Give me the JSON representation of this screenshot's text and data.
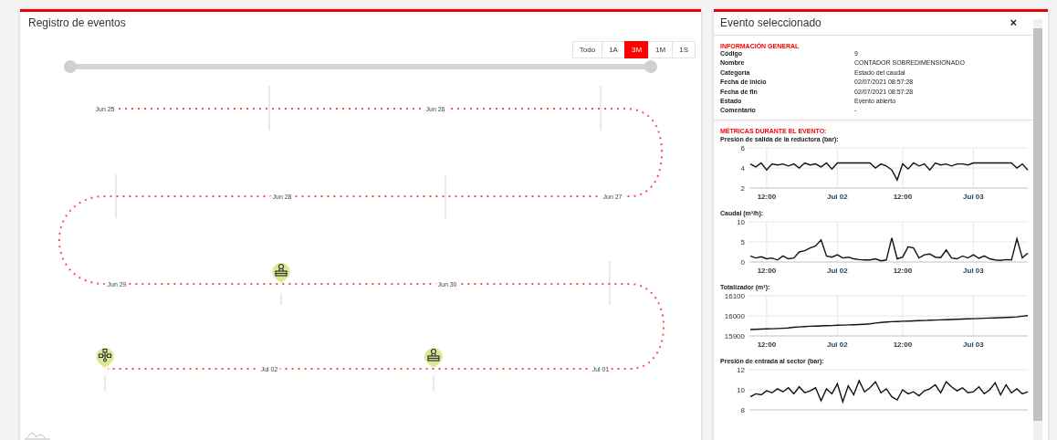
{
  "event_log": {
    "title": "Registro de eventos",
    "range_buttons": [
      {
        "label": "Todo",
        "selected": false
      },
      {
        "label": "1A",
        "selected": false
      },
      {
        "label": "3M",
        "selected": true
      },
      {
        "label": "1M",
        "selected": false
      },
      {
        "label": "1S",
        "selected": false
      }
    ],
    "range_slider": {
      "level": 1
    },
    "timeline": {
      "dates": [
        "Jun 25",
        "Jun 26",
        "Jun 28",
        "Jun 27",
        "Jun 29",
        "Jun 30",
        "Jul 02",
        "Jul 01"
      ],
      "events": [
        {
          "kind": "meter"
        },
        {
          "kind": "network"
        },
        {
          "kind": "meter"
        }
      ]
    }
  },
  "selected_event": {
    "title": "Evento seleccionado",
    "close": "×",
    "general_heading": "INFORMACIÓN GENERAL",
    "fields": [
      {
        "label": "Código",
        "value": "9"
      },
      {
        "label": "Nombre",
        "value": "CONTADOR SOBREDIMENSIONADO"
      },
      {
        "label": "Categoría",
        "value": "Estado del caudal"
      },
      {
        "label": "Fecha de inicio",
        "value": "02/07/2021 08:57:28"
      },
      {
        "label": "Fecha de fin",
        "value": "02/07/2021 08:57:28"
      },
      {
        "label": "Estado",
        "value": "Evento abierto"
      },
      {
        "label": "Comentario",
        "value": "-"
      }
    ],
    "metrics_heading": "MÉTRICAS DURANTE EL EVENTO:",
    "charts": [
      {
        "chart_data": {
          "type": "line",
          "title": "Presión de salida de la reductora (bar):",
          "grid": true,
          "ylim": [
            2,
            6
          ],
          "yticks": [
            2,
            4,
            6
          ],
          "categories": [
            null,
            null,
            null,
            "12:00",
            null,
            null,
            null,
            null,
            null,
            null,
            null,
            null,
            null,
            null,
            null,
            null,
            "Jul 02",
            null,
            null,
            null,
            null,
            null,
            null,
            null,
            null,
            null,
            null,
            null,
            "12:00",
            null,
            null,
            null,
            null,
            null,
            null,
            null,
            null,
            null,
            null,
            null,
            null,
            "Jul 03",
            null,
            null,
            null,
            null,
            null,
            null,
            null,
            null,
            null,
            null
          ],
          "values": [
            4.4,
            4.1,
            4.5,
            3.8,
            4.4,
            4.3,
            4.4,
            4.2,
            4.4,
            4.0,
            4.5,
            4.3,
            4.4,
            4.1,
            4.5,
            3.9,
            4.5,
            4.5,
            4.5,
            4.5,
            4.5,
            4.5,
            4.5,
            4.0,
            4.4,
            4.2,
            3.8,
            2.8,
            4.4,
            3.9,
            4.5,
            4.2,
            4.4,
            3.8,
            4.5,
            4.3,
            4.4,
            4.2,
            4.4,
            4.4,
            4.3,
            4.5,
            4.5,
            4.5,
            4.5,
            4.5,
            4.5,
            4.5,
            4.5,
            4.0,
            4.4,
            3.8
          ]
        }
      },
      {
        "chart_data": {
          "type": "line",
          "title": "Caudal (m³/h):",
          "grid": true,
          "ylim": [
            0,
            10
          ],
          "yticks": [
            0,
            5,
            10
          ],
          "categories": [
            null,
            null,
            null,
            "12:00",
            null,
            null,
            null,
            null,
            null,
            null,
            null,
            null,
            null,
            null,
            null,
            null,
            "Jul 02",
            null,
            null,
            null,
            null,
            null,
            null,
            null,
            null,
            null,
            null,
            null,
            "12:00",
            null,
            null,
            null,
            null,
            null,
            null,
            null,
            null,
            null,
            null,
            null,
            null,
            "Jul 03",
            null,
            null,
            null,
            null,
            null,
            null,
            null,
            null,
            null,
            null
          ],
          "values": [
            1.5,
            1,
            1.3,
            0.8,
            1,
            0.5,
            1.5,
            0.8,
            1,
            2.5,
            2.8,
            3.5,
            4,
            5.5,
            1.5,
            1.2,
            1.8,
            1,
            1.2,
            0.8,
            0.6,
            0.5,
            0.5,
            0.8,
            0.3,
            0.5,
            6,
            0.8,
            1.2,
            3.8,
            3.5,
            1,
            1.8,
            2,
            1.2,
            1.1,
            3,
            1,
            0.8,
            1.5,
            1,
            1.8,
            0.9,
            1.5,
            0.8,
            0.5,
            0.4,
            0.6,
            0.5,
            5.8,
            1,
            2.2
          ]
        }
      },
      {
        "chart_data": {
          "type": "line",
          "title": "Totalizador (m³):",
          "grid": true,
          "ylim": [
            15900,
            16100
          ],
          "yticks": [
            15900,
            16000,
            16100
          ],
          "categories": [
            null,
            null,
            null,
            "12:00",
            null,
            null,
            null,
            null,
            null,
            null,
            null,
            null,
            null,
            null,
            null,
            null,
            "Jul 02",
            null,
            null,
            null,
            null,
            null,
            null,
            null,
            null,
            null,
            null,
            null,
            "12:00",
            null,
            null,
            null,
            null,
            null,
            null,
            null,
            null,
            null,
            null,
            null,
            null,
            "Jul 03",
            null,
            null,
            null,
            null,
            null,
            null,
            null,
            null,
            null,
            null
          ],
          "values": [
            15932,
            15933,
            15934,
            15935,
            15936,
            15937,
            15938,
            15940,
            15943,
            15945,
            15947,
            15948,
            15949,
            15950,
            15951,
            15952,
            15953,
            15954,
            15955,
            15956,
            15957,
            15958,
            15960,
            15964,
            15967,
            15969,
            15971,
            15972,
            15973,
            15974,
            15975,
            15976,
            15977,
            15978,
            15979,
            15980,
            15981,
            15982,
            15983,
            15984,
            15985,
            15986,
            15987,
            15988,
            15989,
            15990,
            15991,
            15992,
            15993,
            15995,
            15998,
            16001
          ]
        }
      },
      {
        "chart_data": {
          "type": "line",
          "title": "Presión de entrada al sector (bar):",
          "grid": true,
          "ylim": [
            8,
            12
          ],
          "yticks": [
            8,
            10,
            12
          ],
          "values": [
            9.3,
            9.6,
            9.5,
            9.9,
            9.7,
            10.1,
            9.8,
            10.2,
            9.6,
            10.3,
            9.7,
            9.9,
            10.2,
            8.9,
            10.1,
            9.6,
            10.6,
            8.8,
            10.4,
            9.5,
            10.9,
            9.8,
            10.2,
            10.8,
            9.7,
            10.1,
            9.3,
            9.0,
            10.0,
            9.6,
            9.8,
            9.4,
            9.9,
            10.1,
            10.5,
            9.7,
            10.8,
            10.3,
            9.9,
            10.2,
            9.7,
            9.8,
            10.3,
            9.6,
            10.0,
            10.7,
            9.5,
            10.5,
            9.7,
            10.1,
            9.6,
            9.8
          ]
        }
      }
    ]
  }
}
